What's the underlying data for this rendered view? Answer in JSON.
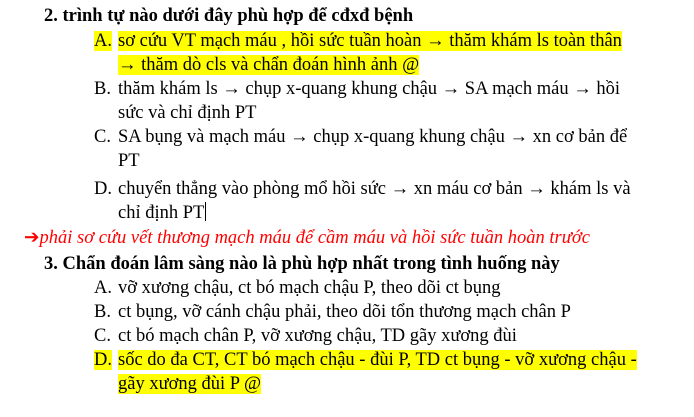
{
  "q2": {
    "title": "2.  trình tự nào dưới đây phù hợp để cđxđ bệnh",
    "options": [
      {
        "letter": "A.",
        "lines": [
          "sơ cứu VT mạch máu , hồi sức tuần hoàn → thăm khám ls toàn thân",
          "→ thăm dò cls và chẩn đoán hình ảnh @"
        ],
        "highlighted": true
      },
      {
        "letter": "B.",
        "lines": [
          "thăm khám ls → chụp x-quang khung chậu → SA mạch máu → hồi",
          "sức và chỉ định PT"
        ],
        "highlighted": false
      },
      {
        "letter": "C.",
        "lines": [
          "SA bụng và mạch máu → chụp x-quang khung chậu → xn cơ bản để",
          "PT"
        ],
        "highlighted": false
      },
      {
        "letter": "D.",
        "lines": [
          "chuyển thẳng vào phòng mổ hồi sức → xn máu cơ bản → khám ls và",
          "chỉ định PT"
        ],
        "highlighted": false
      }
    ]
  },
  "note": {
    "arrow": "➔",
    "text": "phải sơ cứu vết thương mạch máu để cầm máu và hồi sức tuần hoàn trước",
    "color": "#ff0000"
  },
  "q3": {
    "title": "3.  Chẩn đoán lâm sàng nào là phù hợp nhất trong tình huống này",
    "options": [
      {
        "letter": "A.",
        "lines": [
          "vỡ xương chậu, ct bó mạch chậu P, theo dõi ct bụng"
        ],
        "highlighted": false
      },
      {
        "letter": "B.",
        "lines": [
          "ct bụng, vỡ cánh chậu phải, theo dõi tổn thương mạch chân P"
        ],
        "highlighted": false
      },
      {
        "letter": "C.",
        "lines": [
          "ct bó mạch chân P, vỡ xương chậu, TD gãy xương đùi"
        ],
        "highlighted": false
      },
      {
        "letter": "D.",
        "lines": [
          "sốc do đa CT, CT bó mạch chậu - đùi P, TD ct bụng - vỡ xương chậu -",
          "gãy xương đùi P @"
        ],
        "highlighted": true
      }
    ]
  },
  "colors": {
    "highlight": "#ffff00",
    "text": "#000000"
  }
}
